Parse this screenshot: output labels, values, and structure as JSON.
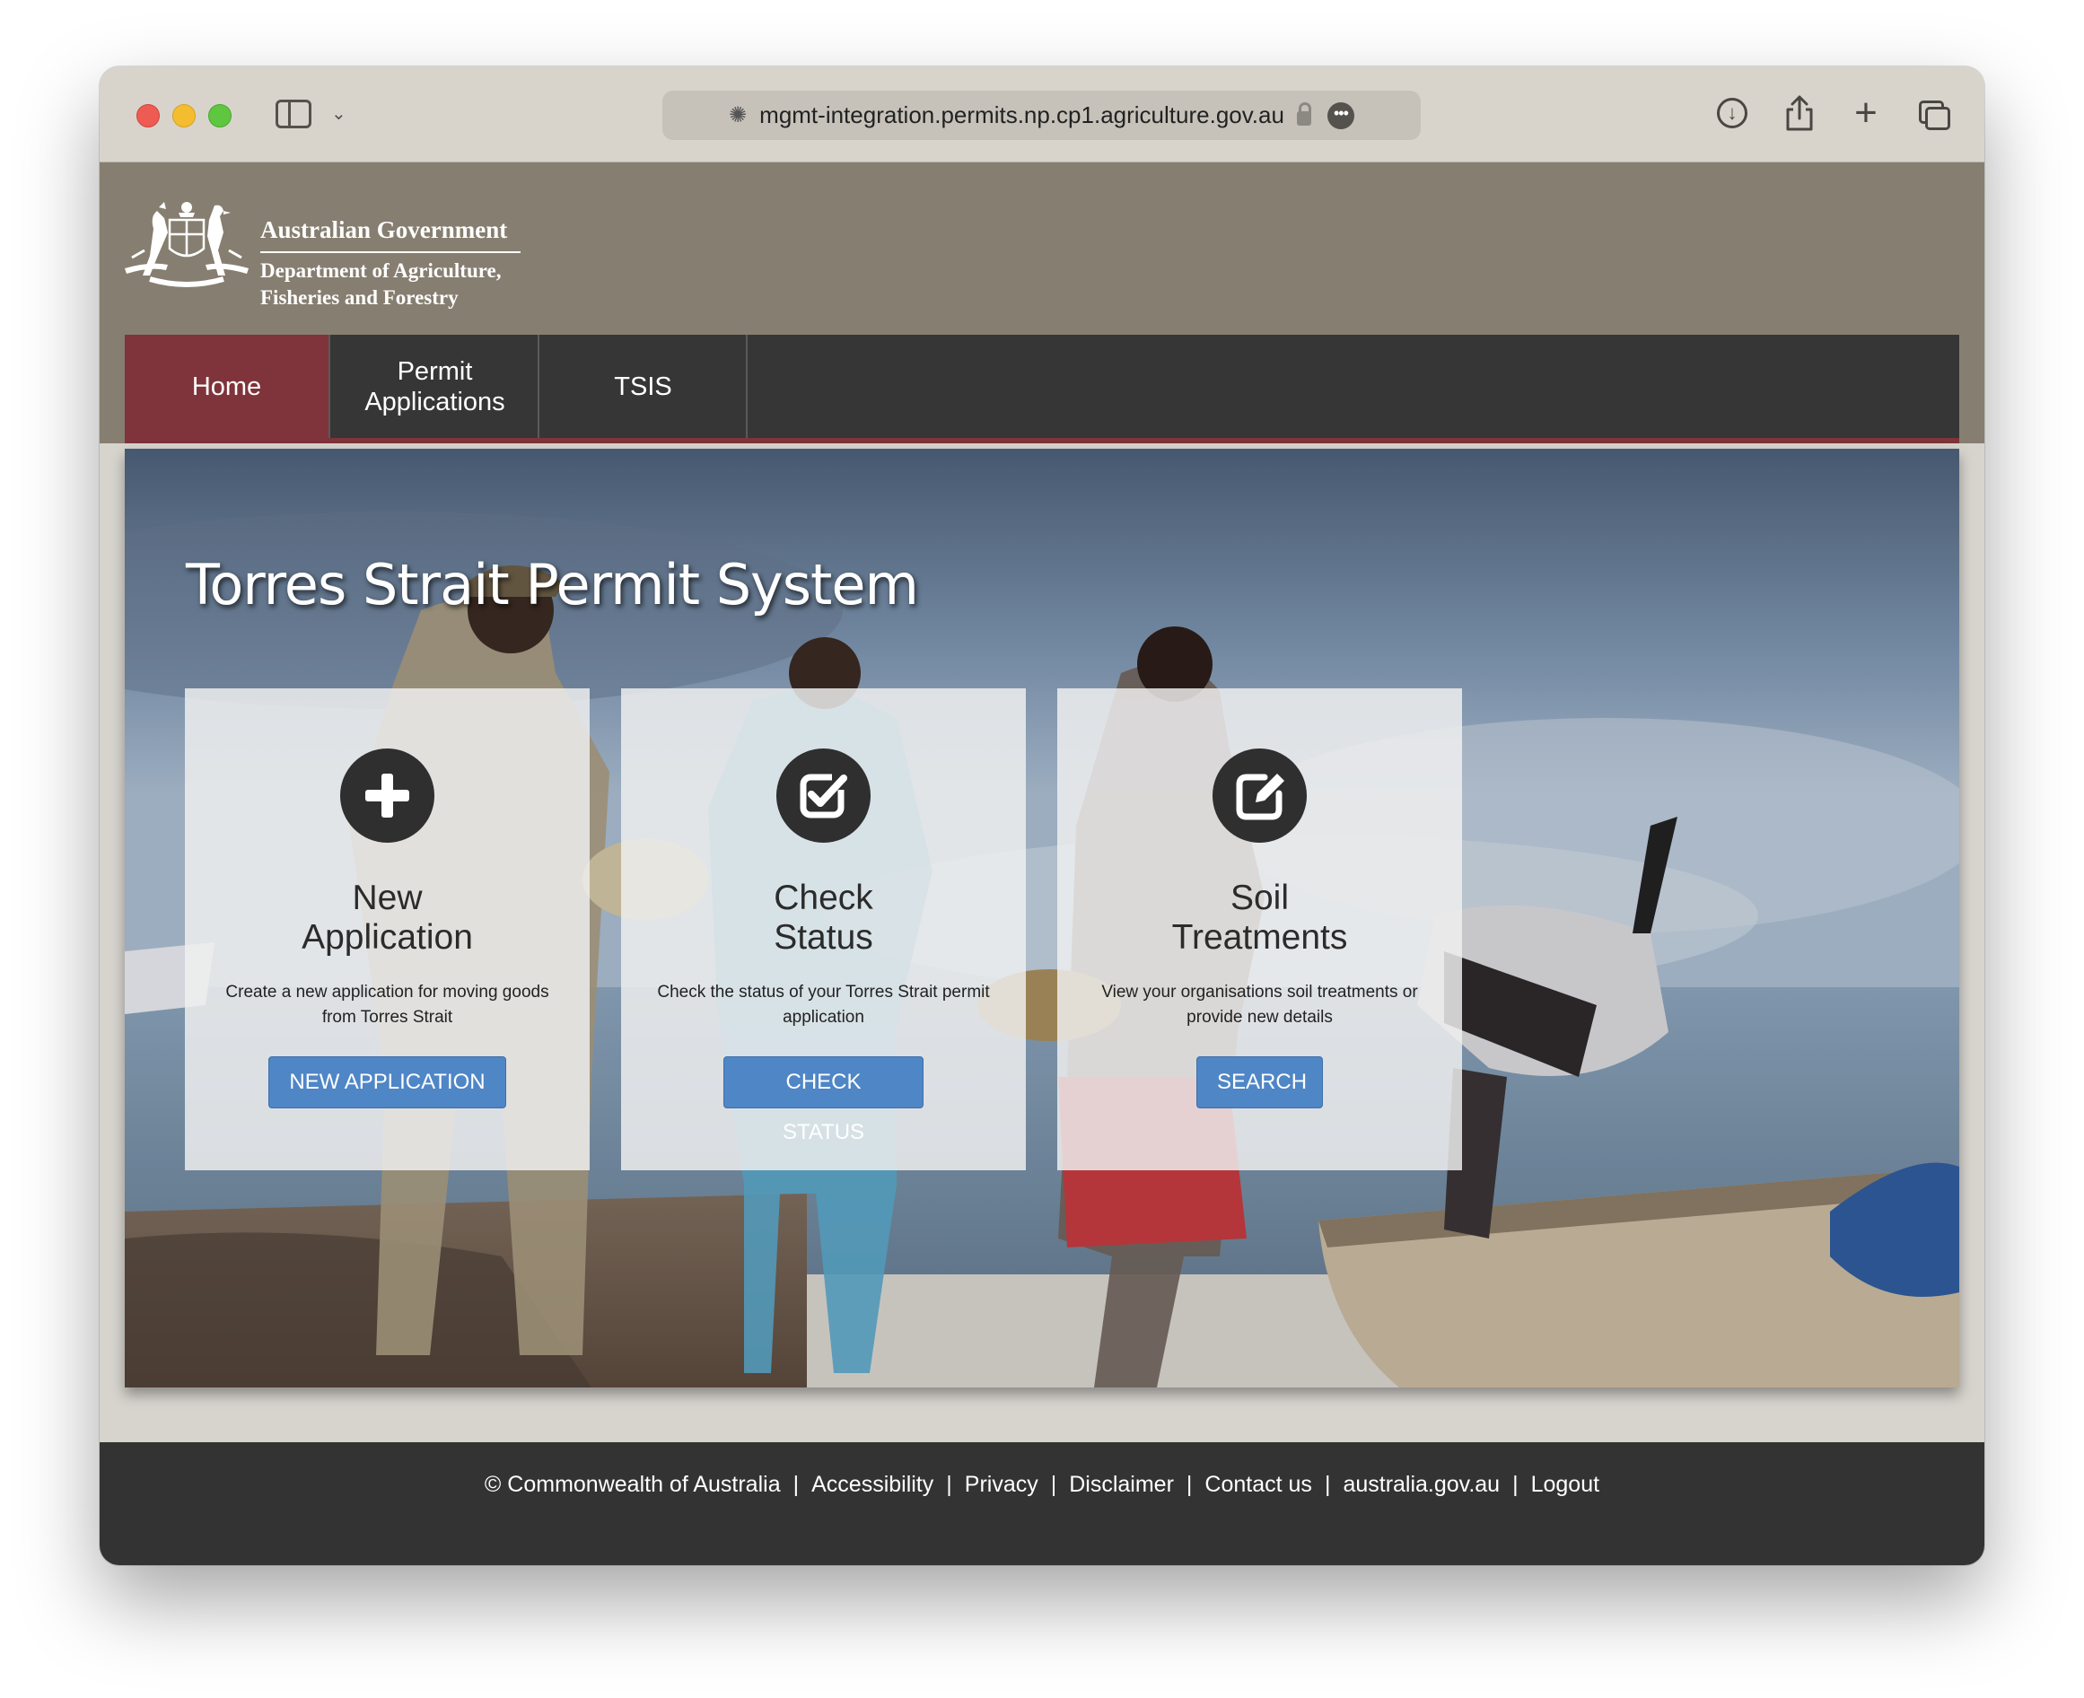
{
  "browser": {
    "url": "mgmt-integration.permits.np.cp1.agriculture.gov.au",
    "more_label": "•••"
  },
  "header": {
    "gov_name": "Australian Government",
    "dept_name_line1": "Department of Agriculture,",
    "dept_name_line2": "Fisheries and Forestry"
  },
  "nav": {
    "items": [
      {
        "label": "Home",
        "active": true
      },
      {
        "label": "Permit Applications",
        "active": false
      },
      {
        "label": "TSIS",
        "active": false
      }
    ]
  },
  "hero": {
    "title": "Torres Strait Permit System",
    "cards": [
      {
        "icon": "plus-circle-icon",
        "title_line1": "New",
        "title_line2": "Application",
        "description": "Create a new application for moving goods from Torres Strait",
        "button": "NEW APPLICATION"
      },
      {
        "icon": "check-square-icon",
        "title_line1": "Check",
        "title_line2": "Status",
        "description": "Check the status of your Torres Strait permit application",
        "button": "CHECK STATUS"
      },
      {
        "icon": "edit-icon",
        "title_line1": "Soil",
        "title_line2": "Treatments",
        "description": "View your organisations soil treatments or provide new details",
        "button": "SEARCH"
      }
    ]
  },
  "footer": {
    "links": [
      "© Commonwealth of Australia",
      "Accessibility",
      "Privacy",
      "Disclaimer",
      "Contact us",
      "australia.gov.au",
      "Logout"
    ],
    "separator": "|"
  },
  "colors": {
    "header_bg": "#867e70",
    "nav_bg": "#363636",
    "nav_active": "#7f333a",
    "button_bg": "#4f86c6",
    "footer_bg": "#333333"
  }
}
